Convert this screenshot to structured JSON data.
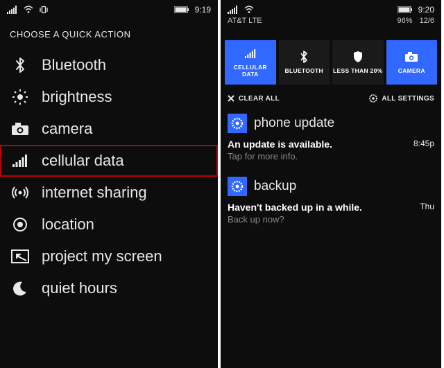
{
  "left": {
    "status": {
      "time": "9:19"
    },
    "title": "CHOOSE A QUICK ACTION",
    "items": [
      {
        "label": "Bluetooth"
      },
      {
        "label": "brightness"
      },
      {
        "label": "camera"
      },
      {
        "label": "cellular data"
      },
      {
        "label": "internet sharing"
      },
      {
        "label": "location"
      },
      {
        "label": "project my screen"
      },
      {
        "label": "quiet hours"
      }
    ]
  },
  "right": {
    "status": {
      "time": "9:20",
      "carrier": "AT&T LTE",
      "battery_pct": "96%",
      "date": "12/6"
    },
    "tiles": [
      {
        "label": "CELLULAR DATA"
      },
      {
        "label": "BLUETOOTH"
      },
      {
        "label": "LESS THAN 20%"
      },
      {
        "label": "CAMERA"
      }
    ],
    "clear_all": "CLEAR ALL",
    "all_settings": "ALL SETTINGS",
    "notifications": [
      {
        "title": "phone update",
        "msg": "An update is available.",
        "sub": "Tap for more info.",
        "time": "8:45p"
      },
      {
        "title": "backup",
        "msg": "Haven't backed up in a while.",
        "sub": "Back up now?",
        "time": "Thu"
      }
    ]
  }
}
